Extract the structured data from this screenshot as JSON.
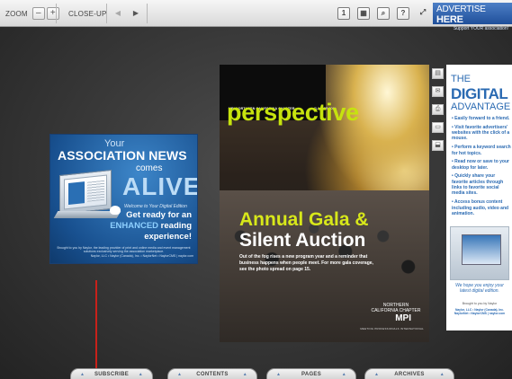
{
  "toolbar": {
    "zoom_label": "ZOOM",
    "zoom_out": "–",
    "zoom_in": "+",
    "closeup_label": "CLOSE-UP",
    "prev_arrow": "◀",
    "next_arrow": "▶",
    "tools": [
      {
        "icon": "single-page-icon",
        "glyph": "1"
      },
      {
        "icon": "grid-view-icon",
        "glyph": "▦"
      },
      {
        "icon": "search-icon",
        "glyph": "⌕"
      },
      {
        "icon": "help-icon",
        "glyph": "?"
      },
      {
        "icon": "fullscreen-icon",
        "glyph": "⤢"
      }
    ],
    "advertise": {
      "main_prefix": "ADVERTISE",
      "main_bold": "HERE",
      "sub": "Support YOUR association!"
    }
  },
  "left_ad": {
    "your": "Your",
    "news": "ASSOCIATION NEWS",
    "comes": "comes",
    "alive": "ALIVE",
    "welcome": "Welcome to Your Digital Edition",
    "line1": "Get ready for an",
    "line2_highlight": "ENHANCED",
    "line2_rest": " reading",
    "line3": "experience!",
    "fine1": "Brought to you by Naylor, the leading provider of print and online media and event management solutions exclusively serving the association marketplace.",
    "fine2": "Naylor, LLC • Naylor (Canada), Inc. • NaylorNet • NaylorCMS | naylor.com"
  },
  "cover": {
    "chapter": "MPI NORTHERN CALIFORNIA CHAPTER",
    "issue": "SUMMER 2011",
    "title": "perspective",
    "event_line1": "Annual Gala &",
    "event_line2": "Silent Auction",
    "blurb": "Out of the fog rises a new program year and a reminder that business happens when people meet. For more gala coverage, see the photo spread on page 15.",
    "chapter_name": "NORTHERN CALIFORNIA CHAPTER",
    "org": "MPI",
    "org_sub": "MEETING PROFESSIONALS INTERNATIONAL"
  },
  "side_tools": [
    {
      "icon": "thumbnail-icon",
      "glyph": "▤"
    },
    {
      "icon": "email-icon",
      "glyph": "✉"
    },
    {
      "icon": "print-icon",
      "glyph": "⎙"
    },
    {
      "icon": "save-icon",
      "glyph": "▭"
    },
    {
      "icon": "download-icon",
      "glyph": "⬓"
    }
  ],
  "right_ad": {
    "the": "THE",
    "digital": "DIGITAL",
    "advantage": "ADVANTAGE",
    "bullets": [
      "• Easily forward to a friend.",
      "• Visit favorite advertisers' websites with the click of a mouse.",
      "• Perform a keyword search for hot topics.",
      "• Read now or save to your desktop for later.",
      "• Quickly share your favorite articles through links to favorite social media sites.",
      "• Access bonus content including audio, video and animation."
    ],
    "enjoy": "We hope you enjoy your latest digital edition.",
    "brought": "Brought to you by Naylor",
    "naylor": "Naylor, LLC • Naylor (Canada), Inc. NaylorNet • NaylorCMS | naylor.com"
  },
  "bottom_tabs": {
    "subscribe": "SUBSCRIBE",
    "contents": "CONTENTS",
    "pages": "PAGES",
    "archives": "ARCHIVES",
    "arrow": "▲"
  }
}
